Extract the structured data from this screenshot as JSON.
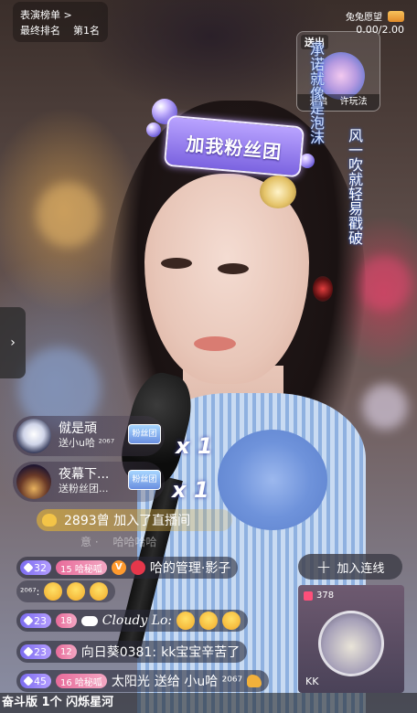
{
  "rank": {
    "title": "表演榜单 >",
    "final_label": "最终排名",
    "position": "第1名"
  },
  "wish": {
    "title": "兔兔愿望",
    "count": "0.00/2.00",
    "card_send": "送出",
    "card_open": "开启 　许玩法",
    "vertical_1": "承诺就像是泡沫",
    "vertical_2": "",
    "vertical_3": "风一吹就轻易戳破"
  },
  "fan_badge": "加我粉丝团",
  "gifts": [
    {
      "name": "僦是頑",
      "sub": "送小u哈 ²⁰⁶⁷",
      "combo": "x 1",
      "icon_label": "粉丝团"
    },
    {
      "name": "夜幕下...",
      "sub": "送粉丝团...",
      "combo": "x 1",
      "icon_label": "粉丝团"
    }
  ],
  "entry": {
    "text": "2893曾 加入了直播间"
  },
  "faint_line": "　　　　意 ·　 哈哈哈哈",
  "chat": [
    {
      "level": "32",
      "fan_level": "15 哈秘呱",
      "name": "哈的管理·影子",
      "content": ""
    },
    {
      "content_prefix": "²⁰⁶⁷:",
      "content": "😭😭😭"
    },
    {
      "level": "23",
      "fan_level": "18",
      "name": "Cloudy Lo:",
      "content": "😭😭😭"
    },
    {
      "level": "23",
      "fan_level": "12",
      "name": "向日葵0381:",
      "content": "kk宝宝辛苦了"
    },
    {
      "level": "45",
      "fan_level": "16 哈秘呱",
      "name": "太阳光",
      "content": "送给 小u哈 ²⁰⁶⁷"
    }
  ],
  "join_button": "加入连线",
  "cohost": {
    "viewers": "378",
    "name": "KK"
  },
  "ticker": "奋斗版 1个 闪烁星河",
  "colors": {
    "level_badge": "#7b6cf0",
    "fan_badge": "#e86b9a",
    "entry_banner": "#d6aa3c",
    "fan_club": "#9b82f0"
  }
}
